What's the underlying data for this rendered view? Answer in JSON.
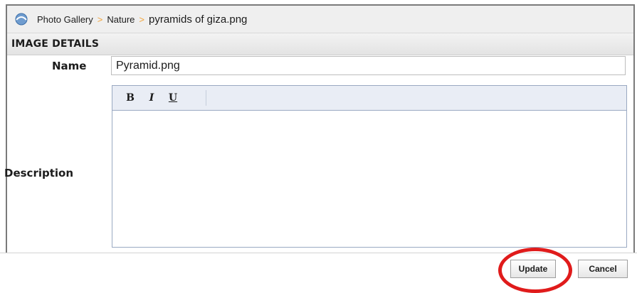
{
  "breadcrumb": {
    "icon": "gallery-home-icon",
    "items": [
      "Photo Gallery",
      "Nature"
    ],
    "separator": ">",
    "current": "pyramids of giza.png"
  },
  "section": {
    "title": "IMAGE DETAILS"
  },
  "form": {
    "name_label": "Name",
    "name_value": "Pyramid.png",
    "description_label": "Description",
    "description_value": ""
  },
  "editor_toolbar": {
    "bold": "B",
    "italic": "I",
    "underline": "U"
  },
  "actions": {
    "update_label": "Update",
    "cancel_label": "Cancel"
  },
  "colors": {
    "breadcrumb_separator": "#f2a43a",
    "highlight": "#e01b1b"
  }
}
